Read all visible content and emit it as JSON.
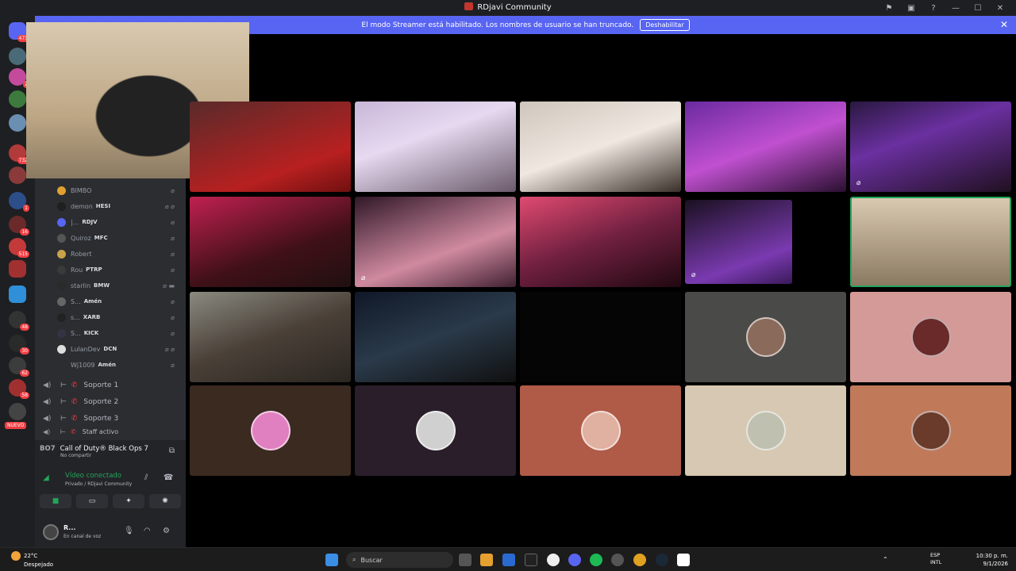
{
  "window": {
    "title": "RDjavi Community"
  },
  "banner": {
    "text": "El modo Streamer está habilitado. Los nombres de usuario se han truncado.",
    "button": "Deshabilitar"
  },
  "servers": {
    "new_label": "NUEVO",
    "badges": [
      "473",
      "2",
      "732",
      "1",
      "16",
      "515",
      "1",
      "48",
      "30",
      "62",
      "58"
    ]
  },
  "voice_users": [
    {
      "name": "BIMBO",
      "tag": ""
    },
    {
      "name": "demon",
      "tag": "HESI"
    },
    {
      "name": "|...",
      "tag": "RDJV"
    },
    {
      "name": "Quiroz",
      "tag": "MFC"
    },
    {
      "name": "Robert",
      "tag": ""
    },
    {
      "name": "Rou",
      "tag": "PTRP"
    },
    {
      "name": "starlin",
      "tag": "BMW"
    },
    {
      "name": "S...",
      "tag": "Amén"
    },
    {
      "name": "s...",
      "tag": "XARB"
    },
    {
      "name": "S...",
      "tag": "KICK"
    },
    {
      "name": "LulanDev",
      "tag": "DCN"
    },
    {
      "name": "Wj1009",
      "tag": "Amén"
    }
  ],
  "channels": [
    "Soporte 1",
    "Soporte 2",
    "Soporte 3",
    "Staff activo"
  ],
  "activity": {
    "game": "Call of Duty® Black Ops 7",
    "sub": "No compartir"
  },
  "voice": {
    "status": "Vídeo conectado",
    "location": "Privado / RDjavi Community"
  },
  "user": {
    "name": "R...",
    "status": "En canal de voz"
  },
  "taskbar": {
    "temp": "22°C",
    "weather": "Despejado",
    "search": "Buscar",
    "lang1": "ESP",
    "lang2": "INTL",
    "time": "10:30 p. m.",
    "date": "9/1/2026"
  },
  "colors": {
    "accent": "#5865f2",
    "danger": "#f23f43",
    "online": "#23a55a",
    "sidebar": "#2b2d31",
    "rail": "#1e1f22"
  }
}
